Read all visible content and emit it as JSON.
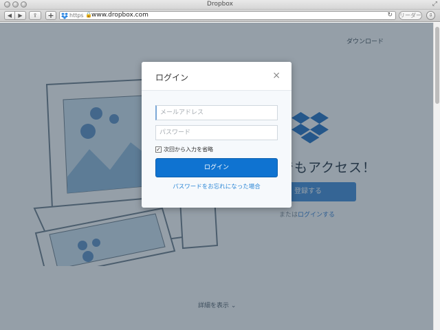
{
  "window": {
    "title": "Dropbox"
  },
  "toolbar": {
    "back_glyph": "◀",
    "forward_glyph": "▶",
    "share_glyph": "⇪",
    "newtab_glyph": "+",
    "scheme": "https",
    "url": "www.dropbox.com",
    "reload_glyph": "↻",
    "reader_label": "リーダー",
    "download_glyph": "⇩"
  },
  "page": {
    "nav_download": "ダウンロード",
    "hero_title": "でもアクセス！",
    "signup_label": "登録する",
    "or_text": "または",
    "login_link": "ログインする",
    "more_link": "詳細を表示 ⌄"
  },
  "modal": {
    "title": "ログイン",
    "close_glyph": "×",
    "email_placeholder": "メールアドレス",
    "password_placeholder": "パスワード",
    "remember_label": "次回から入力を省略",
    "login_button": "ログイン",
    "forgot_link": "パスワードをお忘れになった場合"
  },
  "colors": {
    "overlay": "#2b3f52",
    "brand_blue": "#0f73d1",
    "link_blue": "#2c87d6"
  }
}
